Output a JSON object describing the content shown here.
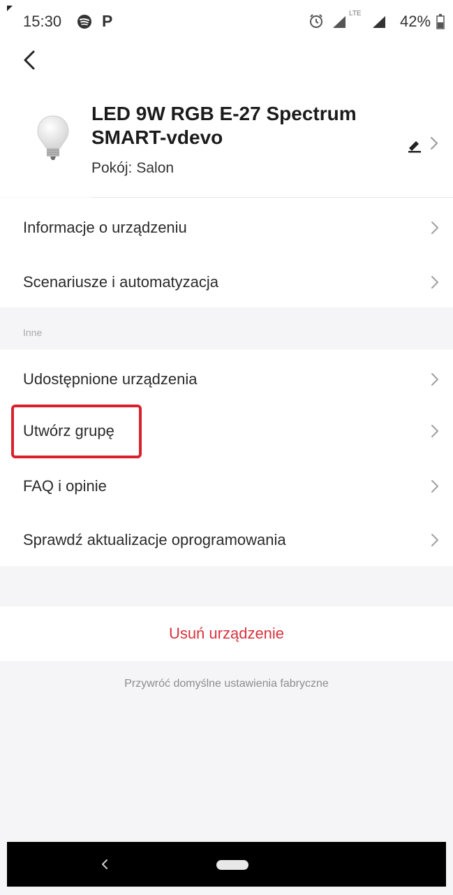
{
  "status_bar": {
    "time": "15:30",
    "lte": "LTE",
    "battery": "42%",
    "icons": [
      "spotify-icon",
      "p-icon",
      "alarm-icon",
      "signal-icon",
      "signal-icon",
      "battery-icon"
    ]
  },
  "header": {
    "back_icon": "chevron-left-icon",
    "device_name": "LED 9W RGB E-27 Spectrum SMART-vdevo",
    "room_label": "Pokój:",
    "room_value": "Salon",
    "edit_icon": "pencil-icon"
  },
  "main_menu": [
    {
      "label": "Informacje o urządzeniu"
    },
    {
      "label": "Scenariusze i automatyzacja"
    }
  ],
  "other_section": {
    "title": "Inne",
    "items": [
      {
        "label": "Udostępnione urządzenia"
      },
      {
        "label": "Utwórz grupę"
      },
      {
        "label": "FAQ i opinie"
      },
      {
        "label": "Sprawdź aktualizacje oprogramowania"
      }
    ]
  },
  "actions": {
    "remove": "Usuń urządzenie",
    "reset": "Przywróć domyślne ustawienia fabryczne"
  },
  "colors": {
    "remove": "#d8323c",
    "highlight": "#d8212c"
  }
}
